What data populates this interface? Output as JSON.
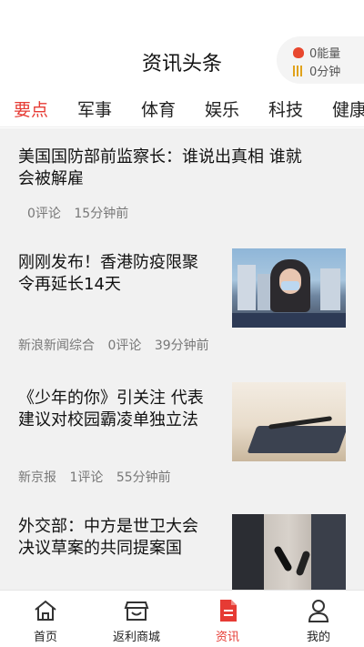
{
  "header": {
    "title": "资讯头条",
    "energy_label": "0能量",
    "time_label": "0分钟"
  },
  "tabs": [
    {
      "label": "要点",
      "active": true
    },
    {
      "label": "军事",
      "active": false
    },
    {
      "label": "体育",
      "active": false
    },
    {
      "label": "娱乐",
      "active": false
    },
    {
      "label": "科技",
      "active": false
    },
    {
      "label": "健康",
      "active": false
    }
  ],
  "articles": [
    {
      "title_line1": "美国国防部前监察长：谁说出真相 谁就",
      "title_line2": "会被解雇",
      "source": "",
      "comments": "0评论",
      "time": "15分钟前"
    },
    {
      "title_line1": "刚刚发布！香港防疫限聚",
      "title_line2": "令再延长14天",
      "source": "新浪新闻综合",
      "comments": "0评论",
      "time": "39分钟前"
    },
    {
      "title_line1": "《少年的你》引关注 代表",
      "title_line2": "建议对校园霸凌单独立法",
      "source": "新京报",
      "comments": "1评论",
      "time": "55分钟前"
    },
    {
      "title_line1": "外交部：中方是世卫大会",
      "title_line2": "决议草案的共同提案国",
      "source": "",
      "comments": "",
      "time": ""
    }
  ],
  "bottom_nav": [
    {
      "label": "首页",
      "icon": "home-icon",
      "active": false
    },
    {
      "label": "返利商城",
      "icon": "shop-icon",
      "active": false
    },
    {
      "label": "资讯",
      "icon": "news-icon",
      "active": true
    },
    {
      "label": "我的",
      "icon": "profile-icon",
      "active": false
    }
  ],
  "colors": {
    "accent": "#e63b34",
    "feed_bg": "#f1f1f1"
  }
}
